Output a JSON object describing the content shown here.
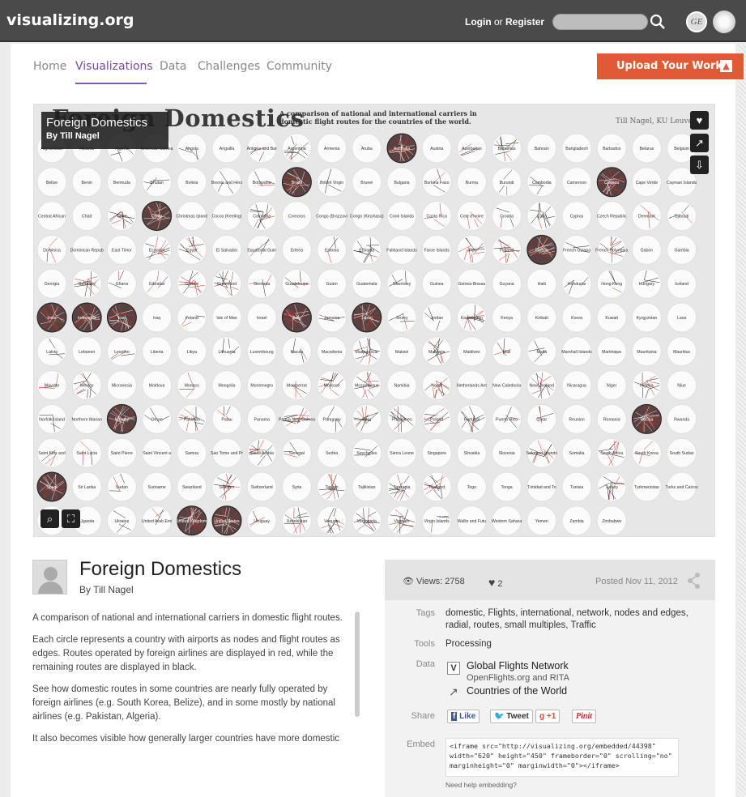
{
  "header": {
    "brand": "visualizing.org",
    "login": "Login",
    "or": "or",
    "register": "Register",
    "search_placeholder": "",
    "ge_logo": "GE"
  },
  "nav": {
    "items": [
      "Home",
      "Visualizations",
      "Data",
      "Challenges",
      "Community"
    ],
    "active": "Visualizations",
    "upload_label": "Upload Your Work"
  },
  "viz": {
    "overlay_title": "Foreign Domestics",
    "overlay_author": "By Till Nagel",
    "big_title": "Foreign Domestics",
    "subtitle_line1": "A comparison of national and international carriers in",
    "subtitle_line2": "domestic flight routes for the countries of the world.",
    "credit": "Till Nagel, KU Leuven",
    "countries": [
      "Afghanistan",
      "Albania",
      "Algeria",
      "American Samoa",
      "Angola",
      "Anguilla",
      "Antigua and Barbuda",
      "Argentina",
      "Armenia",
      "Aruba",
      "Australia",
      "Austria",
      "Azerbaijan",
      "Bahamas",
      "Bahrain",
      "Bangladesh",
      "Barbados",
      "Belarus",
      "Belgium",
      "Belize",
      "Benin",
      "Bermuda",
      "Bhutan",
      "Bolivia",
      "Bosnia and Herzegovina",
      "Botswana",
      "Brazil",
      "British Virgin Islands",
      "Brunei",
      "Bulgaria",
      "Burkina Faso",
      "Burma",
      "Burundi",
      "Cambodia",
      "Cameroon",
      "Canada",
      "Cape Verde",
      "Cayman Islands",
      "Central African Republic",
      "Chad",
      "Chile",
      "China",
      "Christmas Island",
      "Cocos (Keeling) Islands",
      "Colombia",
      "Comoros",
      "Congo (Brazzaville)",
      "Congo (Kinshasa)",
      "Cook Islands",
      "Costa Rica",
      "Cote d'Ivoire",
      "Croatia",
      "Cuba",
      "Cyprus",
      "Czech Republic",
      "Denmark",
      "Djibouti",
      "Dominica",
      "Dominican Republic",
      "East Timor",
      "Ecuador",
      "Egypt",
      "El Salvador",
      "Equatorial Guinea",
      "Eritrea",
      "Estonia",
      "Ethiopia",
      "Falkland Islands",
      "Faroe Islands",
      "Fiji",
      "Finland",
      "France",
      "French Guiana",
      "French Polynesia",
      "Gabon",
      "Gambia",
      "Georgia",
      "Germany",
      "Ghana",
      "Gibraltar",
      "Greece",
      "Greenland",
      "Grenada",
      "Guadeloupe",
      "Guam",
      "Guatemala",
      "Guernsey",
      "Guinea",
      "Guinea-Bissau",
      "Guyana",
      "Haiti",
      "Honduras",
      "Hong Kong",
      "Hungary",
      "Iceland",
      "India",
      "Indonesia",
      "Iran",
      "Iraq",
      "Ireland",
      "Isle of Man",
      "Israel",
      "Italy",
      "Jamaica",
      "Japan",
      "Jersey",
      "Jordan",
      "Kazakhstan",
      "Kenya",
      "Kiribati",
      "Korea",
      "Kuwait",
      "Kyrgyzstan",
      "Laos",
      "Latvia",
      "Lebanon",
      "Lesotho",
      "Liberia",
      "Libya",
      "Lithuania",
      "Luxembourg",
      "Macau",
      "Macedonia",
      "Madagascar",
      "Malawi",
      "Malaysia",
      "Maldives",
      "Mali",
      "Malta",
      "Marshall Islands",
      "Martinique",
      "Mauritania",
      "Mauritius",
      "Mayotte",
      "Mexico",
      "Micronesia",
      "Moldova",
      "Monaco",
      "Mongolia",
      "Montenegro",
      "Montserrat",
      "Morocco",
      "Mozambique",
      "Namibia",
      "Nepal",
      "Netherlands Antilles",
      "New Caledonia",
      "New Zealand",
      "Nicaragua",
      "Niger",
      "Nigeria",
      "Niue",
      "Norfolk Island",
      "Northern Mariana Islands",
      "Norway",
      "Oman",
      "Pakistan",
      "Palau",
      "Panama",
      "Papua New Guinea",
      "Paraguay",
      "Peru",
      "Philippines",
      "Poland",
      "Portugal",
      "Puerto Rico",
      "Qatar",
      "Reunion",
      "Romania",
      "Russia",
      "Rwanda",
      "Saint Kitts and Nevis",
      "Saint Lucia",
      "Saint Pierre",
      "Saint Vincent and the Grenadines",
      "Samoa",
      "Sao Tome and Principe",
      "Saudi Arabia",
      "Senegal",
      "Serbia",
      "Seychelles",
      "Sierra Leone",
      "Singapore",
      "Slovakia",
      "Slovenia",
      "Solomon Islands",
      "Somalia",
      "South Africa",
      "South Korea",
      "South Sudan",
      "Spain",
      "Sri Lanka",
      "Sudan",
      "Suriname",
      "Swaziland",
      "Sweden",
      "Switzerland",
      "Syria",
      "Taiwan",
      "Tajikistan",
      "Tanzania",
      "Thailand",
      "Togo",
      "Tonga",
      "Trinidad and Tobago",
      "Tunisia",
      "Turkey",
      "Turkmenistan",
      "Turks and Caicos",
      "Tuvalu",
      "Uganda",
      "Ukraine",
      "United Arab Emirates",
      "United Kingdom",
      "United States",
      "Uruguay",
      "Uzbekistan",
      "Vanuatu",
      "Venezuela",
      "Vietnam",
      "Virgin Islands",
      "Wallis and Futuna",
      "Western Sahara",
      "Yemen",
      "Zambia",
      "Zimbabwe"
    ]
  },
  "project": {
    "title": "Foreign Domestics",
    "author": "By Till Nagel",
    "paragraphs": [
      "A comparison of national and international carriers in domestic flight routes.",
      "Each circle represents a country with airports as nodes and flight routes as edges. Routes operated by foreign airlines are displayed in red, while the remaining routes are displayed in black.",
      "See how domestic routes in some countries are nearly fully operated by foreign airlines (e.g. South Korea, Belize), and in some mostly by national airlines (e.g. Pakistan, Algeria).",
      "It also becomes visible how generally larger countries have more domestic"
    ]
  },
  "meta": {
    "views_label": "Views: 2758",
    "likes": "2",
    "posted": "Posted Nov 11, 2012",
    "tags_label": "Tags",
    "tags": "domestic, Flights, international, network, nodes and edges, radial, routes, small multiples, Traffic",
    "tools_label": "Tools",
    "tools": "Processing",
    "data_label": "Data",
    "data_item1": "Global Flights Network",
    "data_item1_sub": "OpenFlights.org and RITA",
    "data_item2": "Countries of the World",
    "share_label": "Share",
    "share_like": "Like",
    "share_tweet": "Tweet",
    "share_plus": "+1",
    "share_pin": "Pinit",
    "embed_label": "Embed",
    "embed_code": "<iframe src=\"http://visualizing.org/embedded/44398\" width=\"620\" height=\"450\" frameborder=\"0\" scrolling=\"no\" marginheight=\"0\" marginwidth=\"0\"></iframe>",
    "embed_help": "Need help embedding?"
  },
  "colors": {
    "accent": "#e05a35",
    "nav_active": "#7a4aa0",
    "topbar": "#4a4a4a",
    "foreign_route": "#c0392b",
    "domestic_route": "#222222"
  }
}
